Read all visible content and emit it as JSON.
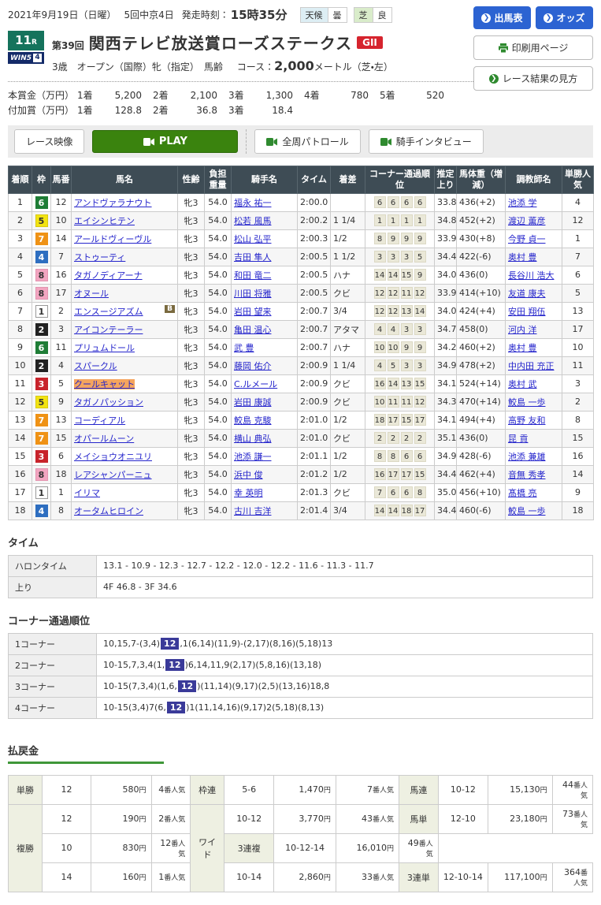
{
  "header": {
    "date": "2021年9月19日（日曜）",
    "meeting": "5回中京4日",
    "start_label": "発走時刻：",
    "start_time": "15時35分",
    "weather_label": "天候",
    "weather_value": "曇",
    "turf_label": "芝",
    "turf_value": "良",
    "actions": {
      "entry_table": "出馬表",
      "odds": "オッズ",
      "print_page": "印刷用ページ",
      "how_to_read": "レース結果の見方"
    }
  },
  "race": {
    "number": "11",
    "number_suffix": "R",
    "win5_label": "WIN5",
    "win5_number": "4",
    "edition": "第39回",
    "title": "関西テレビ放送賞ローズステークス",
    "grade": "GII",
    "conditions": "3歳　オープン（国際）牝（指定）　馬齢",
    "course_label": "コース：",
    "course_value": "2,000",
    "course_unit": "メートル（芝・左）"
  },
  "prizes": [
    {
      "label": "本賞金（万円）",
      "items": [
        {
          "place": "1着",
          "amount": "5,200"
        },
        {
          "place": "2着",
          "amount": "2,100"
        },
        {
          "place": "3着",
          "amount": "1,300"
        },
        {
          "place": "4着",
          "amount": "780"
        },
        {
          "place": "5着",
          "amount": "520"
        }
      ]
    },
    {
      "label": "付加賞（万円）",
      "items": [
        {
          "place": "1着",
          "amount": "128.8"
        },
        {
          "place": "2着",
          "amount": "36.8"
        },
        {
          "place": "3着",
          "amount": "18.4"
        }
      ]
    }
  ],
  "video_bar": {
    "race_video": "レース映像",
    "play": "PLAY",
    "patrol": "全周パトロール",
    "interview": "騎手インタビュー"
  },
  "results": {
    "columns": [
      "着順",
      "枠",
      "馬番",
      "馬名",
      "性齢",
      "負担重量",
      "騎手名",
      "タイム",
      "着差",
      "コーナー通過順位",
      "推定上り",
      "馬体重（増減）",
      "調教師名",
      "単勝人気"
    ],
    "frame_colors": {
      "1": {
        "bg": "#ffffff",
        "fg": "#333333",
        "bd": "#999999"
      },
      "2": {
        "bg": "#222222",
        "fg": "#ffffff",
        "bd": "#222222"
      },
      "3": {
        "bg": "#c8232b",
        "fg": "#ffffff",
        "bd": "#c8232b"
      },
      "4": {
        "bg": "#2e6ec0",
        "fg": "#ffffff",
        "bd": "#2e6ec0"
      },
      "5": {
        "bg": "#f2e312",
        "fg": "#333333",
        "bd": "#d8ca10"
      },
      "6": {
        "bg": "#1f7d36",
        "fg": "#ffffff",
        "bd": "#1f7d36"
      },
      "7": {
        "bg": "#ef9215",
        "fg": "#ffffff",
        "bd": "#ef9215"
      },
      "8": {
        "bg": "#f2a5c0",
        "fg": "#333333",
        "bd": "#e394b0"
      }
    },
    "rows": [
      {
        "pos": "1",
        "frame": "6",
        "num": "12",
        "horse": "アンドヴァラナウト",
        "blinker": false,
        "highlight": false,
        "sex_age": "牝3",
        "weight": "54.0",
        "jockey": "福永 祐一",
        "time": "2:00.0",
        "margin": "",
        "corners": [
          "6",
          "6",
          "6",
          "6"
        ],
        "last3f": "33.8",
        "body": "436(+2)",
        "trainer": "池添 学",
        "pop": "4"
      },
      {
        "pos": "2",
        "frame": "5",
        "num": "10",
        "horse": "エイシンヒテン",
        "blinker": false,
        "highlight": false,
        "sex_age": "牝3",
        "weight": "54.0",
        "jockey": "松若 風馬",
        "time": "2:00.2",
        "margin": "1 1/4",
        "corners": [
          "1",
          "1",
          "1",
          "1"
        ],
        "last3f": "34.8",
        "body": "452(+2)",
        "trainer": "渡辺 薫彦",
        "pop": "12"
      },
      {
        "pos": "3",
        "frame": "7",
        "num": "14",
        "horse": "アールドヴィーヴル",
        "blinker": false,
        "highlight": false,
        "sex_age": "牝3",
        "weight": "54.0",
        "jockey": "松山 弘平",
        "time": "2:00.3",
        "margin": "1/2",
        "corners": [
          "8",
          "9",
          "9",
          "9"
        ],
        "last3f": "33.9",
        "body": "430(+8)",
        "trainer": "今野 貞一",
        "pop": "1"
      },
      {
        "pos": "4",
        "frame": "4",
        "num": "7",
        "horse": "ストゥーティ",
        "blinker": false,
        "highlight": false,
        "sex_age": "牝3",
        "weight": "54.0",
        "jockey": "吉田 隼人",
        "time": "2:00.5",
        "margin": "1 1/2",
        "corners": [
          "3",
          "3",
          "3",
          "5"
        ],
        "last3f": "34.4",
        "body": "422(-6)",
        "trainer": "奥村 豊",
        "pop": "7"
      },
      {
        "pos": "5",
        "frame": "8",
        "num": "16",
        "horse": "タガノディアーナ",
        "blinker": false,
        "highlight": false,
        "sex_age": "牝3",
        "weight": "54.0",
        "jockey": "和田 竜二",
        "time": "2:00.5",
        "margin": "ハナ",
        "corners": [
          "14",
          "14",
          "15",
          "9"
        ],
        "last3f": "34.0",
        "body": "436(0)",
        "trainer": "長谷川 浩大",
        "pop": "6"
      },
      {
        "pos": "6",
        "frame": "8",
        "num": "17",
        "horse": "オヌール",
        "blinker": false,
        "highlight": false,
        "sex_age": "牝3",
        "weight": "54.0",
        "jockey": "川田 将雅",
        "time": "2:00.5",
        "margin": "クビ",
        "corners": [
          "12",
          "12",
          "11",
          "12"
        ],
        "last3f": "33.9",
        "body": "414(+10)",
        "trainer": "友道 康夫",
        "pop": "5"
      },
      {
        "pos": "7",
        "frame": "1",
        "num": "2",
        "horse": "エンスージアズム",
        "blinker": true,
        "highlight": false,
        "sex_age": "牝3",
        "weight": "54.0",
        "jockey": "岩田 望来",
        "time": "2:00.7",
        "margin": "3/4",
        "corners": [
          "12",
          "12",
          "13",
          "14"
        ],
        "last3f": "34.0",
        "body": "424(+4)",
        "trainer": "安田 翔伍",
        "pop": "13"
      },
      {
        "pos": "8",
        "frame": "2",
        "num": "3",
        "horse": "アイコンテーラー",
        "blinker": false,
        "highlight": false,
        "sex_age": "牝3",
        "weight": "54.0",
        "jockey": "亀田 温心",
        "time": "2:00.7",
        "margin": "アタマ",
        "corners": [
          "4",
          "4",
          "3",
          "3"
        ],
        "last3f": "34.7",
        "body": "458(0)",
        "trainer": "河内 洋",
        "pop": "17"
      },
      {
        "pos": "9",
        "frame": "6",
        "num": "11",
        "horse": "プリュムドール",
        "blinker": false,
        "highlight": false,
        "sex_age": "牝3",
        "weight": "54.0",
        "jockey": "武 豊",
        "time": "2:00.7",
        "margin": "ハナ",
        "corners": [
          "10",
          "10",
          "9",
          "9"
        ],
        "last3f": "34.2",
        "body": "460(+2)",
        "trainer": "奥村 豊",
        "pop": "10"
      },
      {
        "pos": "10",
        "frame": "2",
        "num": "4",
        "horse": "スパークル",
        "blinker": false,
        "highlight": false,
        "sex_age": "牝3",
        "weight": "54.0",
        "jockey": "藤岡 佑介",
        "time": "2:00.9",
        "margin": "1 1/4",
        "corners": [
          "4",
          "5",
          "3",
          "3"
        ],
        "last3f": "34.9",
        "body": "478(+2)",
        "trainer": "中内田 充正",
        "pop": "11"
      },
      {
        "pos": "11",
        "frame": "3",
        "num": "5",
        "horse": "クールキャット",
        "blinker": false,
        "highlight": true,
        "sex_age": "牝3",
        "weight": "54.0",
        "jockey": "C.ルメール",
        "time": "2:00.9",
        "margin": "クビ",
        "corners": [
          "16",
          "14",
          "13",
          "15"
        ],
        "last3f": "34.1",
        "body": "524(+14)",
        "trainer": "奥村 武",
        "pop": "3"
      },
      {
        "pos": "12",
        "frame": "5",
        "num": "9",
        "horse": "タガノパッション",
        "blinker": false,
        "highlight": false,
        "sex_age": "牝3",
        "weight": "54.0",
        "jockey": "岩田 康誠",
        "time": "2:00.9",
        "margin": "クビ",
        "corners": [
          "10",
          "11",
          "11",
          "12"
        ],
        "last3f": "34.3",
        "body": "470(+14)",
        "trainer": "鮫島 一歩",
        "pop": "2"
      },
      {
        "pos": "13",
        "frame": "7",
        "num": "13",
        "horse": "コーディアル",
        "blinker": false,
        "highlight": false,
        "sex_age": "牝3",
        "weight": "54.0",
        "jockey": "鮫島 克駿",
        "time": "2:01.0",
        "margin": "1/2",
        "corners": [
          "18",
          "17",
          "15",
          "17"
        ],
        "last3f": "34.1",
        "body": "494(+4)",
        "trainer": "高野 友和",
        "pop": "8"
      },
      {
        "pos": "14",
        "frame": "7",
        "num": "15",
        "horse": "オパールムーン",
        "blinker": false,
        "highlight": false,
        "sex_age": "牝3",
        "weight": "54.0",
        "jockey": "横山 典弘",
        "time": "2:01.0",
        "margin": "クビ",
        "corners": [
          "2",
          "2",
          "2",
          "2"
        ],
        "last3f": "35.1",
        "body": "436(0)",
        "trainer": "昆 貢",
        "pop": "15"
      },
      {
        "pos": "15",
        "frame": "3",
        "num": "6",
        "horse": "メイショウオニユリ",
        "blinker": false,
        "highlight": false,
        "sex_age": "牝3",
        "weight": "54.0",
        "jockey": "池添 謙一",
        "time": "2:01.1",
        "margin": "1/2",
        "corners": [
          "8",
          "8",
          "6",
          "6"
        ],
        "last3f": "34.9",
        "body": "428(-6)",
        "trainer": "池添 兼雄",
        "pop": "16"
      },
      {
        "pos": "16",
        "frame": "8",
        "num": "18",
        "horse": "レアシャンパーニュ",
        "blinker": false,
        "highlight": false,
        "sex_age": "牝3",
        "weight": "54.0",
        "jockey": "浜中 俊",
        "time": "2:01.2",
        "margin": "1/2",
        "corners": [
          "16",
          "17",
          "17",
          "15"
        ],
        "last3f": "34.4",
        "body": "462(+4)",
        "trainer": "音無 秀孝",
        "pop": "14"
      },
      {
        "pos": "17",
        "frame": "1",
        "num": "1",
        "horse": "イリマ",
        "blinker": false,
        "highlight": false,
        "sex_age": "牝3",
        "weight": "54.0",
        "jockey": "幸 英明",
        "time": "2:01.3",
        "margin": "クビ",
        "corners": [
          "7",
          "6",
          "6",
          "8"
        ],
        "last3f": "35.0",
        "body": "456(+10)",
        "trainer": "髙橋 亮",
        "pop": "9"
      },
      {
        "pos": "18",
        "frame": "4",
        "num": "8",
        "horse": "オータムヒロイン",
        "blinker": false,
        "highlight": false,
        "sex_age": "牝3",
        "weight": "54.0",
        "jockey": "古川 吉洋",
        "time": "2:01.4",
        "margin": "3/4",
        "corners": [
          "14",
          "14",
          "18",
          "17"
        ],
        "last3f": "34.4",
        "body": "460(-6)",
        "trainer": "鮫島 一歩",
        "pop": "18"
      }
    ]
  },
  "time_section": {
    "heading": "タイム",
    "rows": [
      {
        "label": "ハロンタイム",
        "value": "13.1 - 10.9 - 12.3 - 12.7 - 12.2 - 12.0 - 12.2 - 11.6 - 11.3 - 11.7"
      },
      {
        "label": "上り",
        "value": "4F 46.8 - 3F 34.6"
      }
    ]
  },
  "corner_section": {
    "heading": "コーナー通過順位",
    "rows": [
      {
        "label": "1コーナー",
        "pre": "10,15,7-(3,4)",
        "mark": "12",
        "post": ",1(6,14)(11,9)-(2,17)(8,16)(5,18)13"
      },
      {
        "label": "2コーナー",
        "pre": "10-15,7,3,4(1,",
        "mark": "12",
        "post": ")6,14,11,9(2,17)(5,8,16)(13,18)"
      },
      {
        "label": "3コーナー",
        "pre": "10-15(7,3,4)(1,6,",
        "mark": "12",
        "post": ")(11,14)(9,17)(2,5)(13,16)18,8"
      },
      {
        "label": "4コーナー",
        "pre": "10-15(3,4)7(6,",
        "mark": "12",
        "post": ")1(11,14,16)(9,17)2(5,18)(8,13)"
      }
    ]
  },
  "payout": {
    "heading": "払戻金",
    "rows": [
      [
        {
          "t": "単勝",
          "h": true
        },
        {
          "t": "12",
          "k": "sel"
        },
        {
          "t": "580",
          "k": "amt",
          "u": "円"
        },
        {
          "t": "4",
          "k": "pop",
          "u": "番人気"
        },
        {
          "t": "枠連",
          "h": true
        },
        {
          "t": "5-6",
          "k": "sel"
        },
        {
          "t": "1,470",
          "k": "amt",
          "u": "円"
        },
        {
          "t": "7",
          "k": "pop",
          "u": "番人気"
        },
        {
          "t": "馬連",
          "h": true
        },
        {
          "t": "10-12",
          "k": "sel"
        },
        {
          "t": "15,130",
          "k": "amt",
          "u": "円"
        },
        {
          "t": "44",
          "k": "pop",
          "u": "番人気"
        }
      ],
      [
        {
          "t": "複勝",
          "h": true,
          "rs": 3
        },
        {
          "t": "12",
          "k": "sel"
        },
        {
          "t": "190",
          "k": "amt",
          "u": "円"
        },
        {
          "t": "2",
          "k": "pop",
          "u": "番人気"
        },
        {
          "t": "ワイド",
          "h": true,
          "rs": 3
        },
        {
          "t": "10-12",
          "k": "sel"
        },
        {
          "t": "3,770",
          "k": "amt",
          "u": "円"
        },
        {
          "t": "43",
          "k": "pop",
          "u": "番人気"
        },
        {
          "t": "馬単",
          "h": true
        },
        {
          "t": "12-10",
          "k": "sel"
        },
        {
          "t": "23,180",
          "k": "amt",
          "u": "円"
        },
        {
          "t": "73",
          "k": "pop",
          "u": "番人気"
        }
      ],
      [
        {
          "t": "10",
          "k": "sel"
        },
        {
          "t": "830",
          "k": "amt",
          "u": "円"
        },
        {
          "t": "12",
          "k": "pop",
          "u": "番人気"
        },
        {
          "t": "3連複",
          "h": true
        },
        {
          "t": "10-12-14",
          "k": "sel"
        },
        {
          "t": "16,010",
          "k": "amt",
          "u": "円"
        },
        {
          "t": "49",
          "k": "pop",
          "u": "番人気"
        }
      ],
      [
        {
          "t": "14",
          "k": "sel"
        },
        {
          "t": "160",
          "k": "amt",
          "u": "円"
        },
        {
          "t": "1",
          "k": "pop",
          "u": "番人気"
        },
        {
          "t": "10-14",
          "k": "sel"
        },
        {
          "t": "2,860",
          "k": "amt",
          "u": "円"
        },
        {
          "t": "33",
          "k": "pop",
          "u": "番人気"
        },
        {
          "t": "3連単",
          "h": true
        },
        {
          "t": "12-10-14",
          "k": "sel"
        },
        {
          "t": "117,100",
          "k": "amt",
          "u": "円"
        },
        {
          "t": "364",
          "k": "pop",
          "u": "番人気"
        }
      ]
    ]
  }
}
